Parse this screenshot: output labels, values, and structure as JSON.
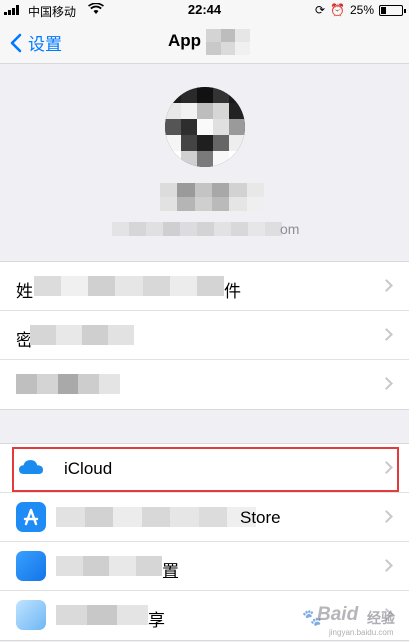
{
  "status_bar": {
    "carrier": "中国移动",
    "time": "22:44",
    "battery": "25%",
    "battery_level": 0.25
  },
  "nav": {
    "back_label": "设置",
    "title": "App"
  },
  "profile": {
    "email_suffix": "om"
  },
  "account_group": [
    {
      "label_start": "姓",
      "label_end": "件"
    },
    {
      "label_start": "密"
    },
    {
      "label_start": ""
    }
  ],
  "services_group": [
    {
      "label": "iCloud",
      "icon": "icloud-icon"
    },
    {
      "label_end": "Store",
      "icon": "app-store-icon"
    },
    {
      "label_end": "置",
      "icon": "app-icon-blue"
    },
    {
      "label_end": "享",
      "icon": "family-sharing-icon"
    }
  ],
  "watermark": {
    "text": "Baid",
    "suffix": "经验",
    "url": "jingyan.baidu.com"
  },
  "colors": {
    "accent": "#007aff",
    "highlight": "#e23b3b",
    "chevron": "#c7c7cc"
  }
}
